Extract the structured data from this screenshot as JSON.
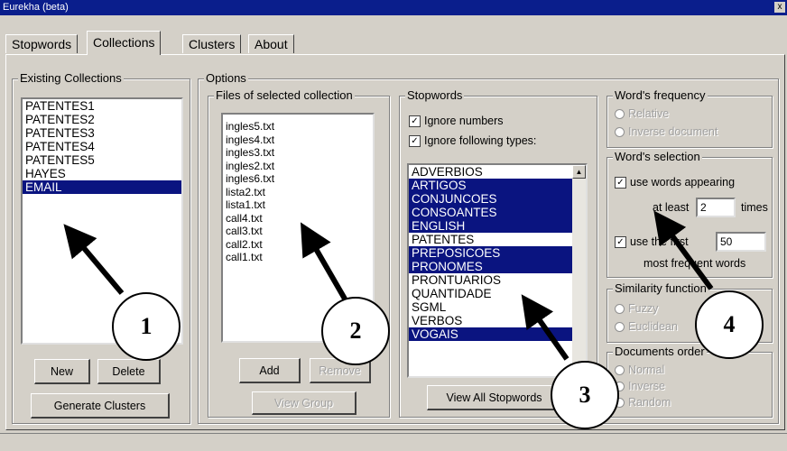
{
  "window": {
    "title": "Eurekha (beta)",
    "close_glyph": "x"
  },
  "tabs": [
    "Stopwords",
    "Collections",
    "Clusters",
    "About"
  ],
  "existing_collections": {
    "label": "Existing Collections",
    "items": [
      "PATENTES1",
      "PATENTES2",
      "PATENTES3",
      "PATENTES4",
      "PATENTES5",
      "HAYES",
      "EMAIL"
    ],
    "selected": "EMAIL",
    "new_label": "New",
    "delete_label": "Delete",
    "generate_label": "Generate Clusters"
  },
  "options": {
    "label": "Options",
    "files": {
      "label": "Files of selected collection",
      "items": [
        "ingles5.txt",
        "ingles4.txt",
        "ingles3.txt",
        "ingles2.txt",
        "ingles6.txt",
        "lista2.txt",
        "lista1.txt",
        "call4.txt",
        "call3.txt",
        "call2.txt",
        "call1.txt"
      ],
      "add_label": "Add",
      "remove_label": "Remove",
      "view_label": "View Group"
    },
    "stopwords": {
      "label": "Stopwords",
      "ignore_numbers": "Ignore numbers",
      "ignore_types": "Ignore following types:",
      "types": [
        "ADVERBIOS",
        "ARTIGOS",
        "CONJUNCOES",
        "CONSOANTES",
        "ENGLISH",
        "PATENTES",
        "PREPOSICOES",
        "PRONOMES",
        "PRONTUARIOS",
        "QUANTIDADE",
        "SGML",
        "VERBOS",
        "VOGAIS"
      ],
      "selected_types": [
        "ARTIGOS",
        "CONJUNCOES",
        "CONSOANTES",
        "ENGLISH",
        "PREPOSICOES",
        "PRONOMES",
        "VOGAIS"
      ],
      "view_all_label": "View All Stopwords"
    },
    "frequency": {
      "label": "Word's frequency",
      "opt1": "Relative",
      "opt2": "Inverse document"
    },
    "selection": {
      "label": "Word's selection",
      "use_appearing": "use words appearing",
      "at_least": "at least",
      "at_least_value": "2",
      "times": "times",
      "use_first": "use the first",
      "first_value": "50",
      "most_frequent": "most frequent words"
    },
    "similarity": {
      "label": "Similarity function",
      "opt1": "Fuzzy",
      "opt2": "Euclidean"
    },
    "documents": {
      "label": "Documents order",
      "opt1": "Normal",
      "opt2": "Inverse",
      "opt3": "Random"
    }
  },
  "callouts": [
    "1",
    "2",
    "3",
    "4"
  ]
}
